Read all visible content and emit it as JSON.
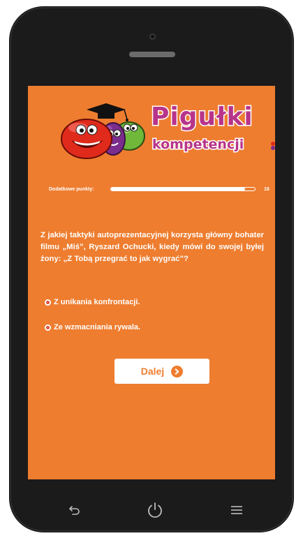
{
  "logo": {
    "word": "Pigułki",
    "subtitle": "kompetencji"
  },
  "progress": {
    "label": "Dodatkowe punkty:",
    "value": "18",
    "fraction": 0.93
  },
  "question": {
    "text": "Z jakiej taktyki autoprezentacyjnej korzysta główny bohater filmu „Miś”, Ryszard Ochucki, kiedy mówi do swojej byłej żony: „Z Tobą przegrać to jak wygrać”?"
  },
  "answers": [
    {
      "label": "Z unikania konfrontacji."
    },
    {
      "label": "Ze wzmacniania rywala."
    }
  ],
  "next_button": {
    "label": "Dalej",
    "icon": "chevron-right-icon"
  },
  "nav": {
    "back_icon": "back-icon",
    "power_icon": "power-icon",
    "menu_icon": "menu-icon"
  },
  "colors": {
    "screen": "#ee7d2f",
    "logo": "#b7348a",
    "phone": "#1b1b1b"
  }
}
